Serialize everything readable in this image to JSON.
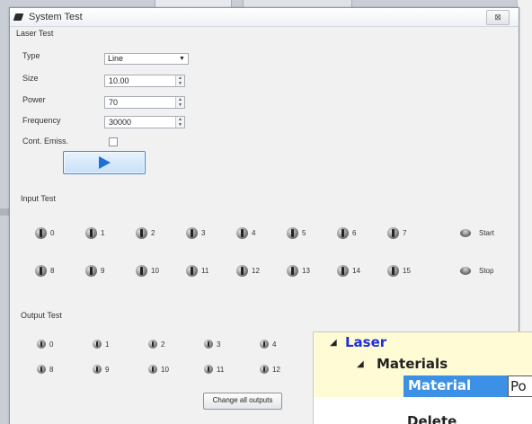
{
  "window": {
    "title": "System Test",
    "close_glyph": "⊠"
  },
  "laser_test": {
    "label": "Laser Test",
    "type": {
      "label": "Type",
      "value": "Line"
    },
    "size": {
      "label": "Size",
      "value": "10.00"
    },
    "power": {
      "label": "Power",
      "value": "70"
    },
    "frequency": {
      "label": "Frequency",
      "value": "30000"
    },
    "cont_emiss": {
      "label": "Cont. Emiss.",
      "checked": false
    }
  },
  "input_test": {
    "label": "Input Test",
    "row1": [
      "0",
      "1",
      "2",
      "3",
      "4",
      "5",
      "6",
      "7"
    ],
    "row2": [
      "8",
      "9",
      "10",
      "11",
      "12",
      "13",
      "14",
      "15"
    ],
    "start_label": "Start",
    "stop_label": "Stop"
  },
  "output_test": {
    "label": "Output Test",
    "row1": [
      "0",
      "1",
      "2",
      "3",
      "4"
    ],
    "row2": [
      "8",
      "9",
      "10",
      "11",
      "12"
    ],
    "change_all_label": "Change all outputs"
  },
  "tree": {
    "laser": "Laser",
    "materials": "Materials",
    "material_label": "Material",
    "material_value": "Po",
    "partial_row": "Delete"
  },
  "icons": {
    "play": "play-icon",
    "led": "toggle-led-icon",
    "expand": "expand-triangle-icon"
  },
  "colors": {
    "accent": "#1e6fd6",
    "tree_selected": "#3c91e6",
    "tree_highlight": "#fffbd4",
    "tree_header_text": "#1e2fdc"
  }
}
